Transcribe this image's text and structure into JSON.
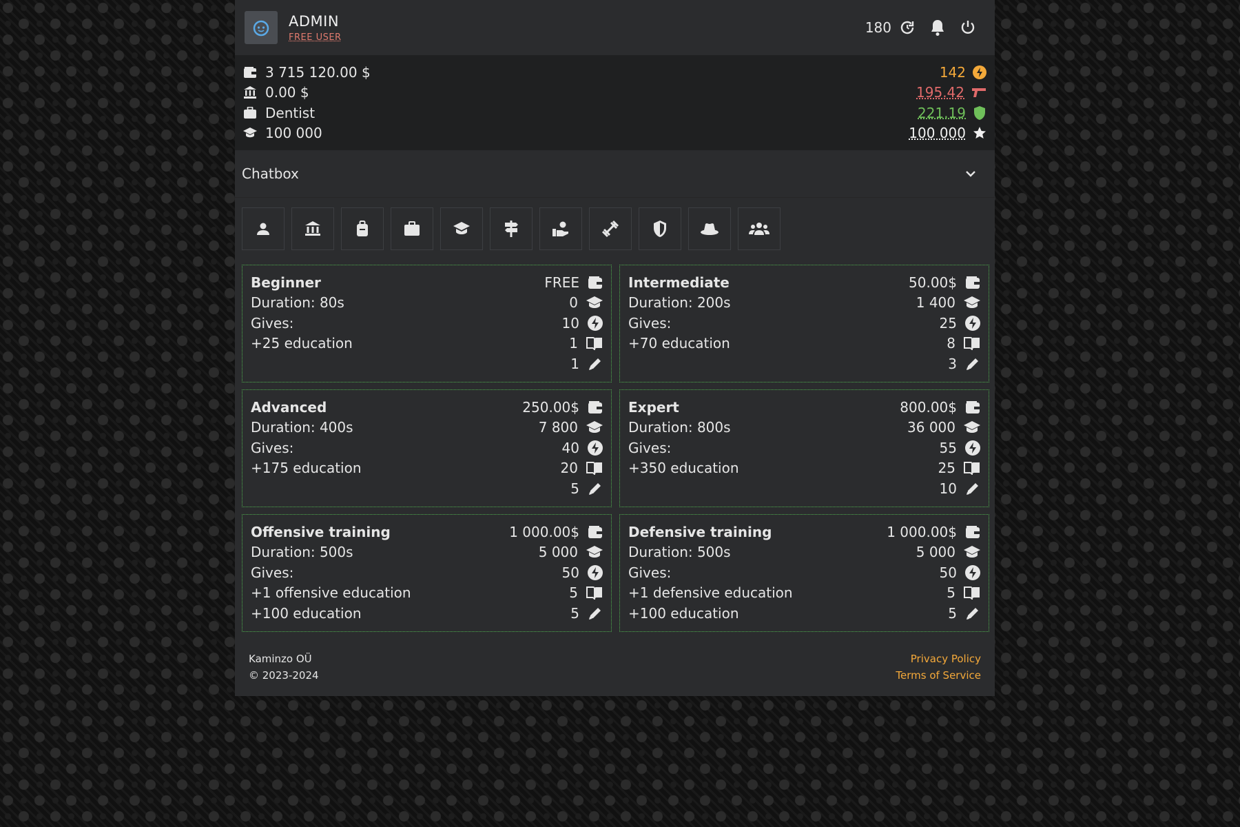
{
  "header": {
    "username": "ADMIN",
    "user_type": "FREE USER",
    "counter": "180",
    "icons": [
      "avatar-icon",
      "refresh-icon",
      "bell-icon",
      "power-icon"
    ]
  },
  "stats": {
    "left": [
      {
        "icon": "wallet-icon",
        "value": "3 715 120.00 $"
      },
      {
        "icon": "bank-icon",
        "value": "0.00 $"
      },
      {
        "icon": "briefcase-icon",
        "value": "Dentist"
      },
      {
        "icon": "graduation-cap-icon",
        "value": "100 000"
      }
    ],
    "right": [
      {
        "icon": "energy-icon",
        "value": "142",
        "color": "#f4a93a"
      },
      {
        "icon": "gun-icon",
        "value": "195.42",
        "color": "#e06a6a"
      },
      {
        "icon": "shield-icon",
        "value": "221.19",
        "color": "#6fbf5a"
      },
      {
        "icon": "star-icon",
        "value": "100 000",
        "color": "#f0f0f0"
      }
    ]
  },
  "chatbox": {
    "label": "Chatbox"
  },
  "tabs": [
    "person-icon",
    "bank-icon",
    "backpack-icon",
    "briefcase-icon",
    "graduation-cap-icon",
    "signpost-icon",
    "hand-holding-icon",
    "dumbbell-icon",
    "shield-icon",
    "hat-icon",
    "group-icon"
  ],
  "courses": [
    {
      "title": "Beginner",
      "duration": "Duration: 80s",
      "gives_label": "Gives:",
      "gives": [
        "+25 education"
      ],
      "price": "FREE",
      "education_req": "0",
      "energy": "10",
      "books": "1",
      "pencils": "1"
    },
    {
      "title": "Intermediate",
      "duration": "Duration: 200s",
      "gives_label": "Gives:",
      "gives": [
        "+70 education"
      ],
      "price": "50.00$",
      "education_req": "1 400",
      "energy": "25",
      "books": "8",
      "pencils": "3"
    },
    {
      "title": "Advanced",
      "duration": "Duration: 400s",
      "gives_label": "Gives:",
      "gives": [
        "+175 education"
      ],
      "price": "250.00$",
      "education_req": "7 800",
      "energy": "40",
      "books": "20",
      "pencils": "5"
    },
    {
      "title": "Expert",
      "duration": "Duration: 800s",
      "gives_label": "Gives:",
      "gives": [
        "+350 education"
      ],
      "price": "800.00$",
      "education_req": "36 000",
      "energy": "55",
      "books": "25",
      "pencils": "10"
    },
    {
      "title": "Offensive training",
      "duration": "Duration: 500s",
      "gives_label": "Gives:",
      "gives": [
        "+1 offensive education",
        "+100 education"
      ],
      "price": "1 000.00$",
      "education_req": "5 000",
      "energy": "50",
      "books": "5",
      "pencils": "5"
    },
    {
      "title": "Defensive training",
      "duration": "Duration: 500s",
      "gives_label": "Gives:",
      "gives": [
        "+1 defensive education",
        "+100 education"
      ],
      "price": "1 000.00$",
      "education_req": "5 000",
      "energy": "50",
      "books": "5",
      "pencils": "5"
    }
  ],
  "footer": {
    "company": "Kaminzo OÜ",
    "copyright": "© 2023-2024",
    "privacy": "Privacy Policy",
    "terms": "Terms of Service"
  }
}
